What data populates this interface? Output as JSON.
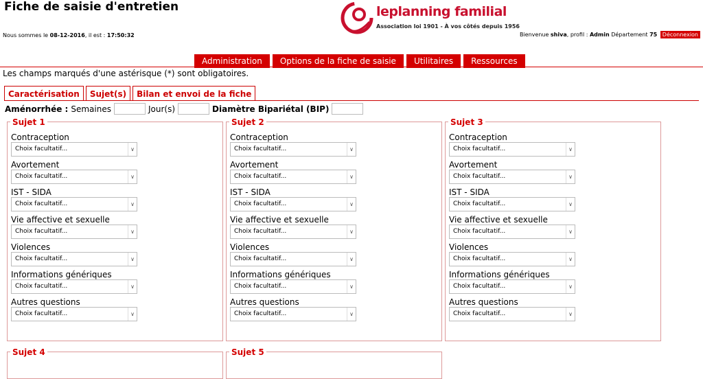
{
  "header": {
    "title": "Fiche de saisie d'entretien",
    "date_prefix": "Nous sommes le",
    "date": "08-12-2016",
    "time_prefix": ", il est :",
    "time": "17:50:32",
    "welcome_prefix": "Bienvenue",
    "user": "shiva",
    "profile_prefix": ", profil :",
    "profile": "Admin",
    "dept_prefix": "Département",
    "dept": "75",
    "logout_label": "Déconnexion"
  },
  "logo": {
    "text": "leplanning familial",
    "subtitle": "Association loi 1901 - À vos côtés depuis 1956"
  },
  "menu": [
    "Administration",
    "Options de la fiche de saisie",
    "Utilitaires",
    "Ressources"
  ],
  "notice": "Les champs marqués d'une astérisque (*) sont obligatoires.",
  "tabs": [
    "Caractérisation",
    "Sujet(s)",
    "Bilan et envoi de la fiche"
  ],
  "amenorrhee": {
    "label": "Aménorrhée :",
    "weeks_label": "Semaines",
    "days_label": "Jour(s)",
    "bip_label": "Diamètre Bipariétal (BIP)"
  },
  "subjects": [
    {
      "legend": "Sujet 1"
    },
    {
      "legend": "Sujet 2"
    },
    {
      "legend": "Sujet 3"
    },
    {
      "legend": "Sujet 4"
    },
    {
      "legend": "Sujet 5"
    }
  ],
  "fields": [
    "Contraception",
    "Avortement",
    "IST - SIDA",
    "Vie affective et sexuelle",
    "Violences",
    "Informations génériques",
    "Autres questions"
  ],
  "select_placeholder": "Choix facultatif...",
  "colors": {
    "accent": "#d40000"
  }
}
